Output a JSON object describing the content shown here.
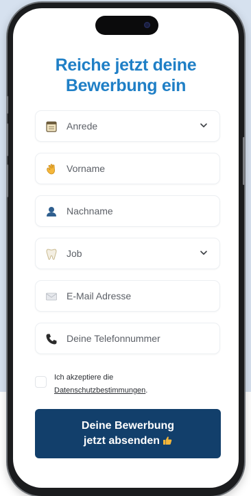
{
  "form": {
    "headline_line1": "Reiche jetzt deine",
    "headline_line2": "Bewerbung ein",
    "fields": [
      {
        "placeholder": "Anrede",
        "icon": "notepad-icon",
        "type": "select"
      },
      {
        "placeholder": "Vorname",
        "icon": "waving-hand-icon",
        "type": "text"
      },
      {
        "placeholder": "Nachname",
        "icon": "person-icon",
        "type": "text"
      },
      {
        "placeholder": "Job",
        "icon": "tooth-icon",
        "type": "select"
      },
      {
        "placeholder": "E-Mail Adresse",
        "icon": "envelope-icon",
        "type": "email"
      },
      {
        "placeholder": "Deine Telefonnummer",
        "icon": "phone-icon",
        "type": "tel"
      }
    ],
    "consent": {
      "prefix": "Ich akzeptiere die",
      "link": "Datenschutzbestimmungen",
      "suffix": "."
    },
    "submit_line1": "Deine Bewerbung",
    "submit_line2": "jetzt absenden",
    "submit_icon": "thumbs-up-icon"
  },
  "colors": {
    "headline": "#1f7fc6",
    "button": "#123f6b",
    "background": "#d6e1ef"
  }
}
